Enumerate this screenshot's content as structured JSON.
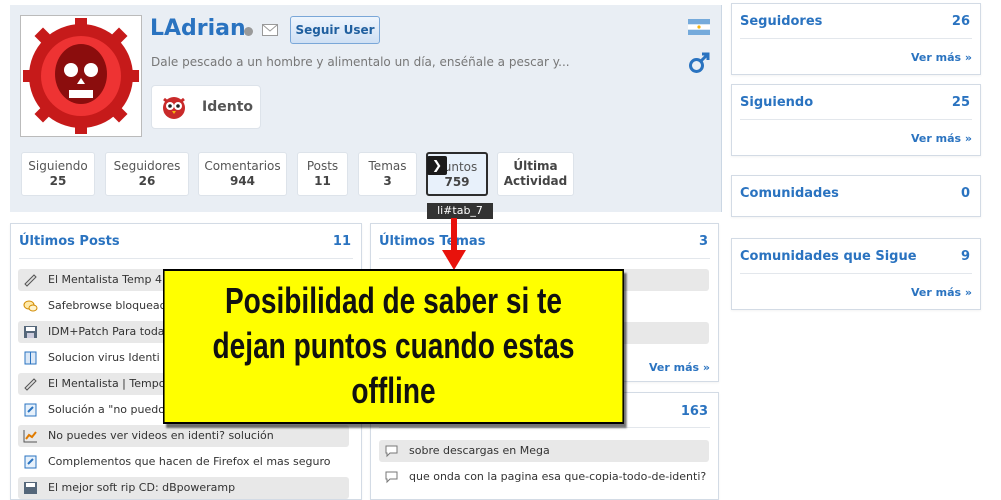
{
  "profile": {
    "username": "LAdrian",
    "follow_label": "Seguir User",
    "tagline": "Dale pescado a un hombre y alimentalo un día, enséñale a pescar y...",
    "rank": "Idento"
  },
  "stats": [
    {
      "label": "Siguiendo",
      "value": "25"
    },
    {
      "label": "Seguidores",
      "value": "26"
    },
    {
      "label": "Comentarios",
      "value": "944"
    },
    {
      "label": "Posts",
      "value": "11"
    },
    {
      "label": "Temas",
      "value": "3"
    },
    {
      "label": "Puntos",
      "value": "759"
    },
    {
      "label": "Última",
      "value": "Actividad"
    }
  ],
  "tooltip": {
    "arrow": "❯",
    "label": "li#tab_7"
  },
  "posts": {
    "title": "Últimos Posts",
    "count": "11",
    "items": [
      "El Mentalista Temp 4 | 2",
      "Safebrowse bloqueado",
      "IDM+Patch Para todas",
      "Solucion virus Identi Sha",
      "El Mentalista | Tempora",
      "Solución a \"no puedo ve",
      "No puedes ver videos en identi? solución",
      "Complementos que hacen de Firefox el mas seguro",
      "El mejor soft rip CD: dBpoweramp"
    ]
  },
  "temas": {
    "title": "Últimos Temas",
    "count": "3",
    "more": "Ver más »"
  },
  "comments": {
    "count": "163",
    "items": [
      "sobre descargas en Mega",
      "que onda con la pagina esa que-copia-todo-de-identi?"
    ]
  },
  "sidebar": [
    {
      "title": "Seguidores",
      "count": "26",
      "more": "Ver más »"
    },
    {
      "title": "Siguiendo",
      "count": "25",
      "more": "Ver más »"
    },
    {
      "title": "Comunidades",
      "count": "0"
    },
    {
      "title": "Comunidades que Sigue",
      "count": "9",
      "more": "Ver más »"
    }
  ],
  "callout": {
    "line1": "Posibilidad de saber si te",
    "line2": "dejan puntos cuando estas",
    "line3": "offline"
  },
  "colors": {
    "link": "#2a73c0",
    "callout_bg": "#ffff00",
    "header_bg": "#e9eef4",
    "arrow": "#e8120c"
  }
}
